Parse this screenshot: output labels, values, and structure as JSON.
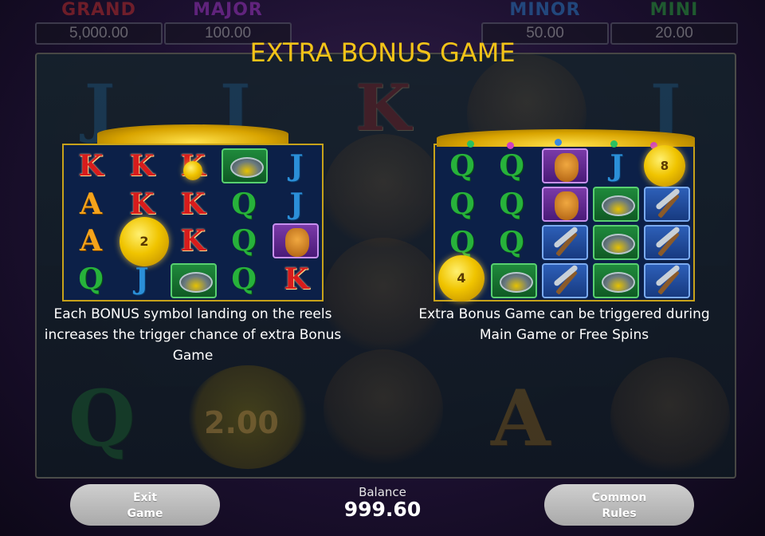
{
  "jackpots": [
    {
      "name": "GRAND",
      "value": "5,000.00",
      "color": "#d8322c"
    },
    {
      "name": "MAJOR",
      "value": "100.00",
      "color": "#b23ad8"
    },
    {
      "name": "MINOR",
      "value": "50.00",
      "color": "#2a8ad8"
    },
    {
      "name": "MINI",
      "value": "20.00",
      "color": "#2ab83a"
    }
  ],
  "background": {
    "coin_value": "2.00"
  },
  "title": "EXTRA BONUS GAME",
  "panel_left": {
    "grid": [
      [
        "K",
        "K",
        "K",
        "pan",
        "J"
      ],
      [
        "A",
        "K",
        "K",
        "Q",
        "J"
      ],
      [
        "A",
        "coin",
        "K",
        "Q",
        "dog"
      ],
      [
        "Q",
        "J",
        "pan",
        "Q",
        "K"
      ]
    ],
    "coin_value": "2",
    "description_lines": [
      "Each BONUS symbol landing on the reels",
      "increases the trigger chance of extra Bonus",
      "Game"
    ]
  },
  "panel_right": {
    "grid": [
      [
        "Q",
        "Q",
        "dog",
        "J",
        "coin"
      ],
      [
        "Q",
        "Q",
        "dog",
        "pan",
        "pick"
      ],
      [
        "Q",
        "Q",
        "pick",
        "pan",
        "pick"
      ],
      [
        "coin",
        "pan",
        "pick",
        "pan",
        "pick"
      ]
    ],
    "coin_values": [
      "8",
      "4"
    ],
    "description_lines": [
      "Extra Bonus Game can be triggered during",
      "Main Game or Free Spins"
    ]
  },
  "footer": {
    "exit_label_line1": "Exit",
    "exit_label_line2": "Game",
    "balance_label": "Balance",
    "balance_value": "999.60",
    "rules_label_line1": "Common",
    "rules_label_line2": "Rules"
  },
  "icons": [
    "gold-pan-icon",
    "pickaxe-icon",
    "dog-icon",
    "gold-coin-icon"
  ]
}
